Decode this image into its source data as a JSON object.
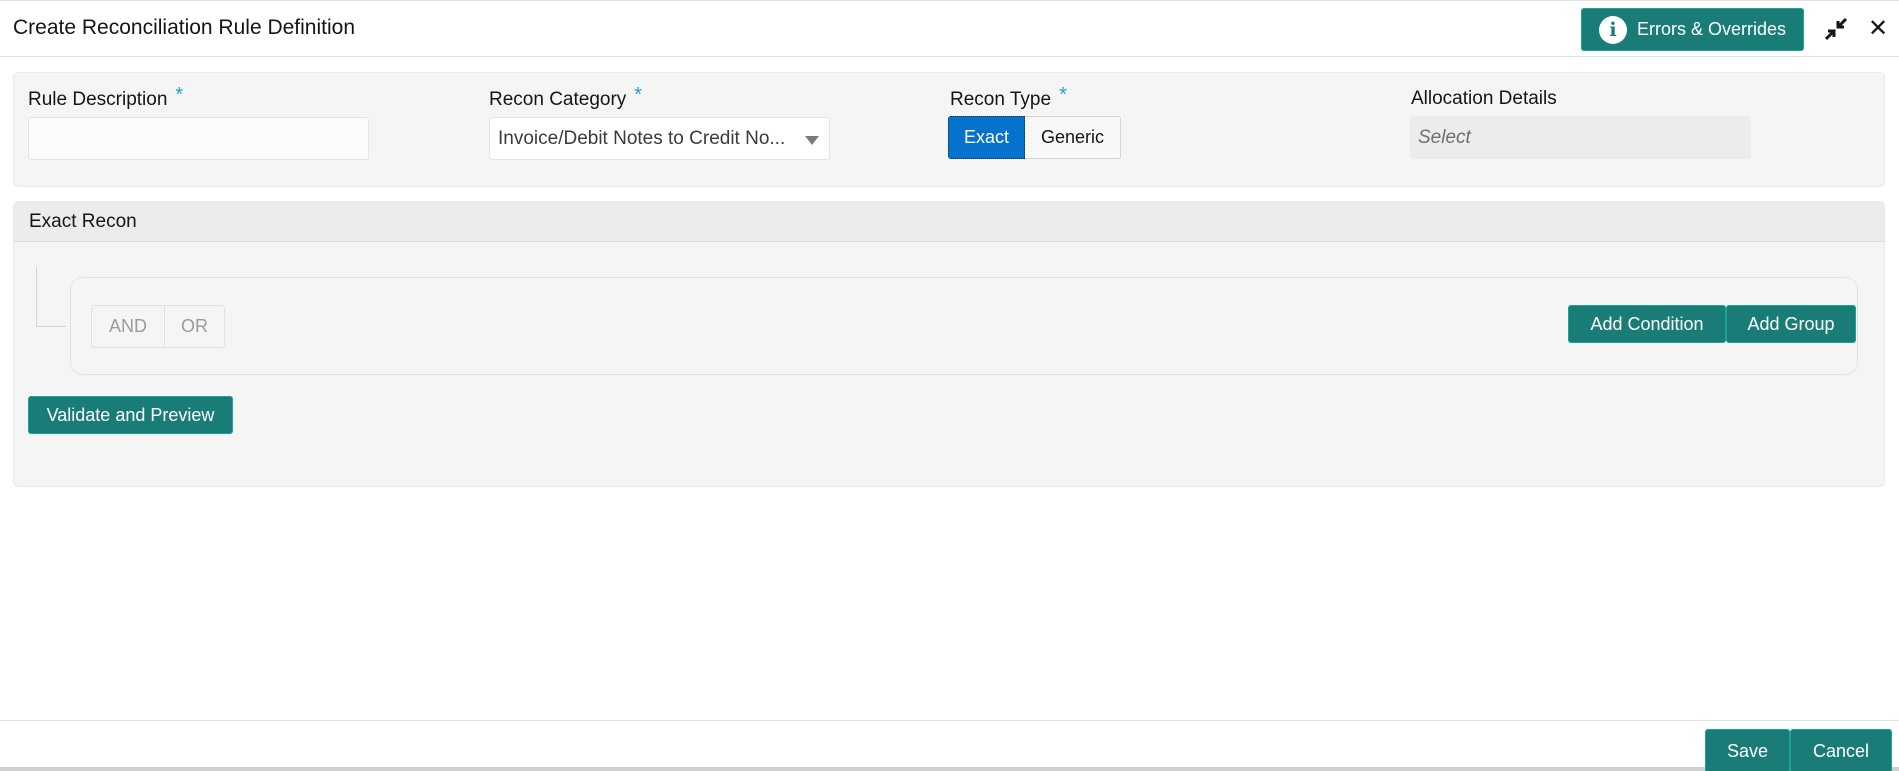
{
  "header": {
    "title": "Create Reconciliation Rule Definition",
    "errors_button_label": "Errors & Overrides",
    "info_icon_glyph": "i",
    "close_icon_glyph": "✕"
  },
  "form": {
    "rule_description": {
      "label": "Rule Description",
      "required_marker": "*",
      "value": ""
    },
    "recon_category": {
      "label": "Recon Category",
      "required_marker": "*",
      "selected": "Invoice/Debit Notes to Credit No..."
    },
    "recon_type": {
      "label": "Recon Type",
      "required_marker": "*",
      "options": [
        "Exact",
        "Generic"
      ],
      "selected": "Exact"
    },
    "allocation_details": {
      "label": "Allocation Details",
      "placeholder": "Select"
    }
  },
  "exact_recon": {
    "title": "Exact Recon",
    "logic_operators": [
      "AND",
      "OR"
    ],
    "add_condition_label": "Add Condition",
    "add_group_label": "Add Group",
    "validate_label": "Validate and Preview"
  },
  "footer": {
    "save_label": "Save",
    "cancel_label": "Cancel"
  },
  "colors": {
    "primary_teal": "#1a7c77",
    "toggle_active_blue": "#0572ce",
    "required_asterisk": "#1aa3d9"
  }
}
